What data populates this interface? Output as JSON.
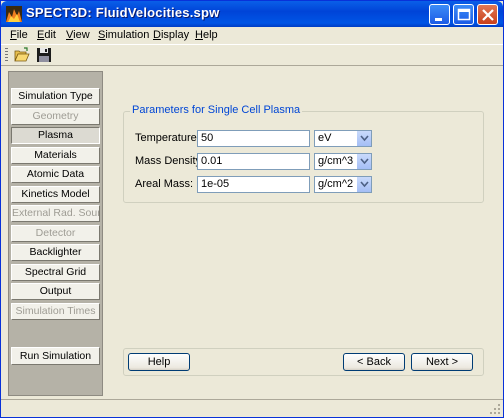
{
  "window": {
    "title": "SPECT3D:  FluidVelocities.spw",
    "colors": {
      "titlebar": "#0054e3",
      "accent": "#0046d5",
      "close": "#c9401a"
    }
  },
  "menu": [
    "File",
    "Edit",
    "View",
    "Simulation",
    "Display",
    "Help"
  ],
  "toolbar": {
    "icons": [
      "open-folder-icon",
      "save-disk-icon"
    ]
  },
  "sidebar": {
    "items": [
      {
        "label": "Simulation Type",
        "state": "enabled"
      },
      {
        "label": "Geometry",
        "state": "disabled"
      },
      {
        "label": "Plasma",
        "state": "active"
      },
      {
        "label": "Materials",
        "state": "enabled"
      },
      {
        "label": "Atomic Data",
        "state": "enabled"
      },
      {
        "label": "Kinetics Model",
        "state": "enabled"
      },
      {
        "label": "External Rad. Source",
        "state": "disabled"
      },
      {
        "label": "Detector",
        "state": "disabled"
      },
      {
        "label": "Backlighter",
        "state": "enabled"
      },
      {
        "label": "Spectral Grid",
        "state": "enabled"
      },
      {
        "label": "Output",
        "state": "enabled"
      },
      {
        "label": "Simulation Times",
        "state": "disabled"
      }
    ],
    "run_button": "Run Simulation"
  },
  "panel": {
    "group_title": "Parameters for Single Cell Plasma",
    "fields": [
      {
        "label": "Temperature:",
        "value": "50",
        "unit": "eV"
      },
      {
        "label": "Mass Density:",
        "value": "0.01",
        "unit": "g/cm^3"
      },
      {
        "label": "Areal Mass:",
        "value": "1e-05",
        "unit": "g/cm^2"
      }
    ]
  },
  "buttons": {
    "help": "Help",
    "back": "< Back",
    "next": "Next >"
  }
}
